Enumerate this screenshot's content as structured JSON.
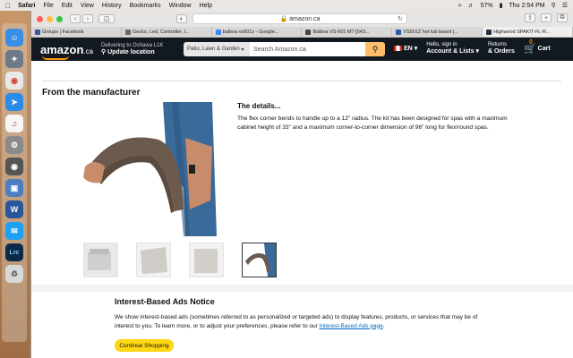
{
  "menubar": {
    "app": "Safari",
    "items": [
      "File",
      "Edit",
      "View",
      "History",
      "Bookmarks",
      "Window",
      "Help"
    ],
    "battery": "57%",
    "clock": "Thu 2:54 PM"
  },
  "browser": {
    "url": "amazon.ca",
    "tabs": [
      {
        "label": "Groups | Facebook",
        "color": "#3b5998"
      },
      {
        "label": "Gecko, Led, Controller, I...",
        "color": "#666666"
      },
      {
        "label": "balboa vs501z - Google...",
        "color": "#4285f4"
      },
      {
        "label": "Balboa VS-501 M7 [543...",
        "color": "#444444"
      },
      {
        "label": "VS501Z hot tub board |...",
        "color": "#2c5aa0"
      },
      {
        "label": "Highwood SPAKIT-FL-R...",
        "color": "#232f3e"
      }
    ]
  },
  "header": {
    "logo": "amazon",
    "logo_tld": ".ca",
    "deliver_line1": "Delivering to Oshawa L1K",
    "deliver_line2": "Update location",
    "search_category": "Patio, Lawn & Garden",
    "search_placeholder": "Search Amazon.ca",
    "lang": "EN",
    "account_line1": "Hello, sign in",
    "account_line2": "Account & Lists",
    "returns_line1": "Returns",
    "returns_line2": "& Orders",
    "cart_count": "0",
    "cart_label": "Cart"
  },
  "main": {
    "section_title": "From the manufacturer",
    "details_title": "The details...",
    "details_text": "The flex corner bends to handle up to a 12\" radius. The kit has been designed for spas with a maximum cabinet height of 33\" and a maximum corner-to-corner dimension of 96\" long for flex/round spas."
  },
  "ads": {
    "title": "Interest-Based Ads Notice",
    "text": "We show interest-based ads (sometimes referred to as personalized or targeted ads) to display features, products, or services that may be of interest to you. To learn more, or to adjust your preferences, please refer to our",
    "link": "Interest-Based Ads page",
    "end": ".",
    "button": "Continue Shopping"
  }
}
